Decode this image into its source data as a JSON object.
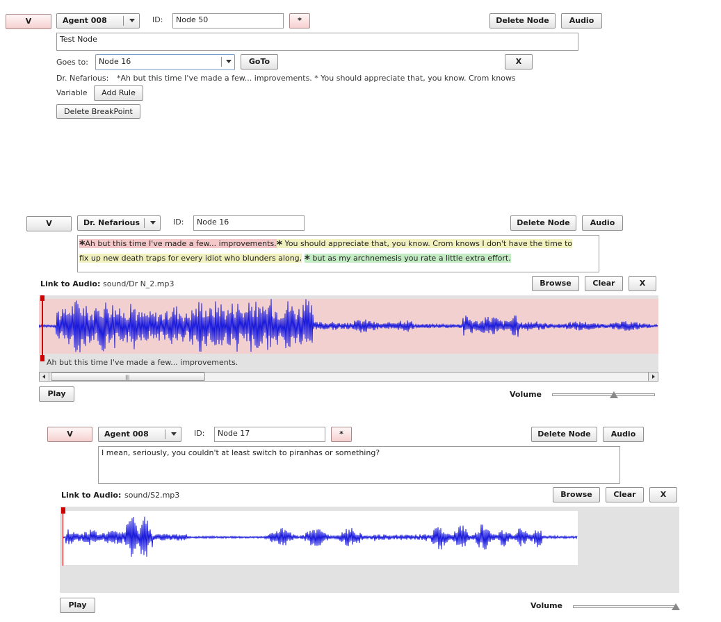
{
  "node1": {
    "v_label": "V",
    "speaker": "Agent 008",
    "id_label": "ID:",
    "id_value": "Node 50",
    "star_label": "*",
    "delete_label": "Delete Node",
    "audio_label": "Audio",
    "text": "Test Node",
    "goes_to_label": "Goes to:",
    "goes_to_value": "Node 16",
    "goto_label": "GoTo",
    "x_label": "X",
    "response_speaker": "Dr. Nefarious:",
    "response_text": "*Ah but this time I've made a few... improvements. * You should appreciate that, you know. Crom knows",
    "variable_label": "Variable",
    "add_rule_label": "Add Rule",
    "delete_breakpoint_label": "Delete BreakPoint"
  },
  "node2": {
    "v_label": "V",
    "speaker": "Dr. Nefarious",
    "id_label": "ID:",
    "id_value": "Node 16",
    "delete_label": "Delete Node",
    "audio_label": "Audio",
    "segments": [
      {
        "star": "*",
        "text": "Ah but this time I've made a few... improvements.",
        "color": "#f4c8c8"
      },
      {
        "star": "*",
        "text": " You should appreciate that, you know. Crom knows I don't have the time to",
        "color": "#f1f1c0"
      },
      {
        "star": "",
        "text": "fix up new death traps for every idiot who blunders along,",
        "color": "#f1f1c0"
      },
      {
        "star": "*",
        "text": " but as my archnemesis you rate a little extra effort.",
        "color": "#c4ecc4"
      }
    ],
    "link_label": "Link to Audio:",
    "audio_file": "sound/Dr N_2.mp3",
    "browse_label": "Browse",
    "clear_label": "Clear",
    "x_label": "X",
    "caption": "Ah but this time I've made a few... improvements.",
    "play_label": "Play",
    "volume_label": "Volume",
    "volume_level": 0.6,
    "wave_bg": "#f2d0d0"
  },
  "node3": {
    "v_label": "V",
    "speaker": "Agent 008",
    "id_label": "ID:",
    "id_value": "Node 17",
    "star_label": "*",
    "delete_label": "Delete Node",
    "audio_label": "Audio",
    "text": "I mean, seriously, you couldn't at least switch to piranhas or something?",
    "link_label": "Link to Audio:",
    "audio_file": "sound/S2.mp3",
    "browse_label": "Browse",
    "clear_label": "Clear",
    "x_label": "X",
    "play_label": "Play",
    "volume_label": "Volume",
    "volume_level": 1.0
  },
  "colors": {
    "waveform": "#1a1adc",
    "playhead": "#cc0000",
    "panel_gray": "#e2e2e2"
  }
}
